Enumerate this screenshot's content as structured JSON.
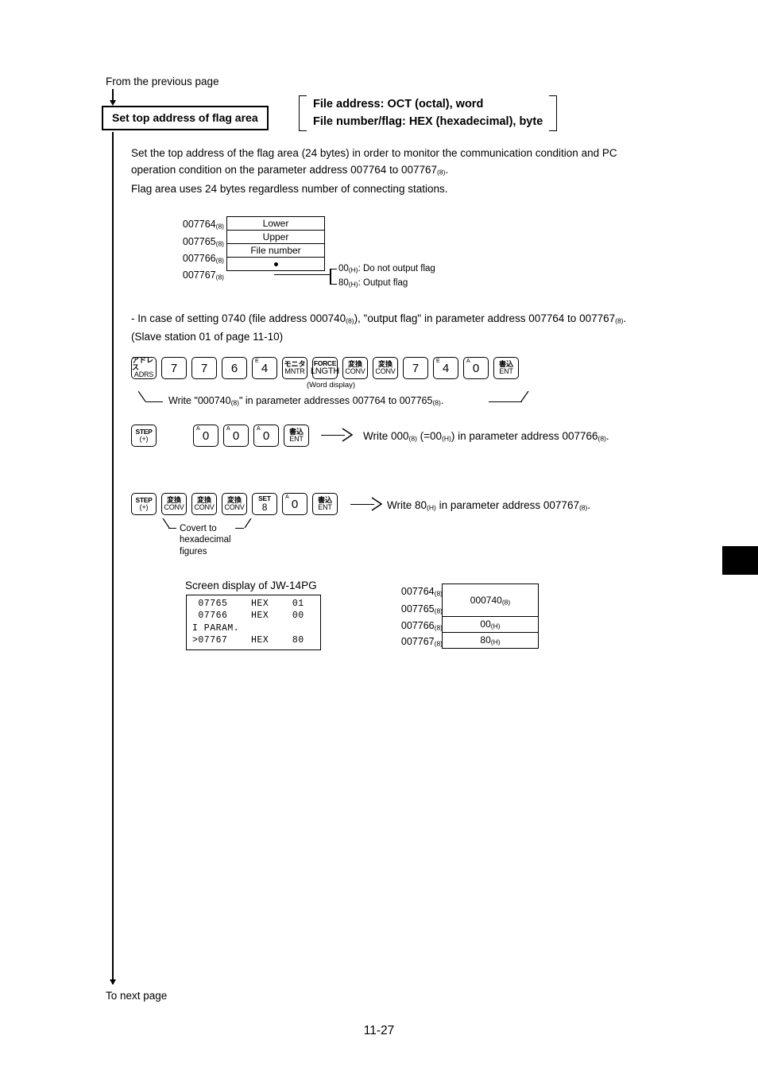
{
  "page": {
    "from_previous": "From the previous page",
    "to_next": "To next page",
    "page_number": "11-27"
  },
  "heading": {
    "title": "Set top address of flag area"
  },
  "note": {
    "line1": "File address: OCT (octal), word",
    "line2": "File number/flag: HEX (hexadecimal), byte"
  },
  "intro": {
    "line1_a": "Set the top address of the flag area (24 bytes) in order to monitor the communication condition and PC",
    "line2_a": "operation condition on the parameter address 007764 to 007767",
    "line2_sub": "(8)",
    "line2_b": ".",
    "line3": "Flag area uses 24 bytes regardless number of connecting stations."
  },
  "flag_table": {
    "rows": [
      {
        "addr": "007764",
        "addr_sub": "(8)",
        "value": "Lower"
      },
      {
        "addr": "007765",
        "addr_sub": "(8)",
        "value": "Upper"
      },
      {
        "addr": "007766",
        "addr_sub": "(8)",
        "value": "File number"
      },
      {
        "addr": "007767",
        "addr_sub": "(8)",
        "value": ""
      }
    ],
    "callouts": [
      {
        "code": "00",
        "code_sub": "(H)",
        "text": ": Do not output flag"
      },
      {
        "code": "80",
        "code_sub": "(H)",
        "text": ": Output flag"
      }
    ]
  },
  "example": {
    "line1_a": "- In case of setting   0740 (file address 000740",
    "line1_sub1": "(8)",
    "line1_b": "), \"output flag\" in parameter address 007764 to 007767",
    "line1_sub2": "(8)",
    "line1_c": ".",
    "line2": "(Slave station 01 of page 11-10)"
  },
  "key_sequence_1": {
    "keys": [
      {
        "name": "adrs",
        "top": "アドレス",
        "bottom": "ADRS",
        "style": "jp"
      },
      {
        "name": "digit-7",
        "big": "7",
        "style": "big"
      },
      {
        "name": "digit-7",
        "big": "7",
        "style": "big"
      },
      {
        "name": "digit-6",
        "big": "6",
        "style": "big"
      },
      {
        "name": "digit-4",
        "big": "4",
        "corner": "E",
        "style": "big-corner"
      },
      {
        "name": "mntr",
        "top": "モニタ",
        "bottom": "MNTR",
        "style": "jp"
      },
      {
        "name": "lngth",
        "top": "FORCE",
        "bottom": "LNGTH",
        "style": "force"
      },
      {
        "name": "conv",
        "top": "変換",
        "bottom": "CONV",
        "style": "jp"
      },
      {
        "name": "conv",
        "top": "変換",
        "bottom": "CONV",
        "style": "jp"
      },
      {
        "name": "digit-7",
        "big": "7",
        "style": "big"
      },
      {
        "name": "digit-4",
        "big": "4",
        "corner": "E",
        "style": "big-corner"
      },
      {
        "name": "digit-0",
        "big": "0",
        "corner": "A",
        "style": "big-corner"
      },
      {
        "name": "ent",
        "top": "書込",
        "bottom": "ENT",
        "style": "jp"
      }
    ],
    "word_display": "(Word display)",
    "caption_a": "Write \"000740",
    "caption_sub1": "(8)",
    "caption_b": "\" in parameter addresses 007764 to 007765",
    "caption_sub2": "(8)",
    "caption_c": "."
  },
  "key_sequence_2": {
    "keys": [
      {
        "name": "step-plus",
        "top": "STEP",
        "bottom": "(+)",
        "style": "stk"
      },
      {
        "name": "digit-0",
        "big": "0",
        "corner": "A",
        "style": "big-corner"
      },
      {
        "name": "digit-0",
        "big": "0",
        "corner": "A",
        "style": "big-corner"
      },
      {
        "name": "digit-0",
        "big": "0",
        "corner": "A",
        "style": "big-corner"
      },
      {
        "name": "ent",
        "top": "書込",
        "bottom": "ENT",
        "style": "jp"
      }
    ],
    "result_a": "Write 000",
    "result_sub1": "(8)",
    "result_b": " (=00",
    "result_sub2": "(H)",
    "result_c": ") in parameter address 007766",
    "result_sub3": "(8)",
    "result_d": "."
  },
  "key_sequence_3": {
    "keys": [
      {
        "name": "step-plus",
        "top": "STEP",
        "bottom": "(+)",
        "style": "stk"
      },
      {
        "name": "conv",
        "top": "変換",
        "bottom": "CONV",
        "style": "jp"
      },
      {
        "name": "conv",
        "top": "変換",
        "bottom": "CONV",
        "style": "jp"
      },
      {
        "name": "conv",
        "top": "変換",
        "bottom": "CONV",
        "style": "jp"
      },
      {
        "name": "set-8",
        "top": "SET",
        "bottom": "8",
        "style": "stk"
      },
      {
        "name": "digit-0",
        "big": "0",
        "corner": "A",
        "style": "big-corner"
      },
      {
        "name": "ent",
        "top": "書込",
        "bottom": "ENT",
        "style": "jp"
      }
    ],
    "leader_line1": "Covert to",
    "leader_line2": "hexadecimal",
    "leader_line3": "figures",
    "result_a": "Write 80",
    "result_sub1": "(H)",
    "result_b": " in parameter address 007767",
    "result_sub2": "(8)",
    "result_c": "."
  },
  "monitor": {
    "caption": "Screen display of JW-14PG",
    "lines": [
      " 07765    HEX    01",
      " 07766    HEX    00",
      "I PARAM.",
      ">07767    HEX    80"
    ]
  },
  "result_table": {
    "rows": [
      {
        "addr": "007764",
        "addr_sub": "(8)"
      },
      {
        "addr": "007765",
        "addr_sub": "(8)"
      },
      {
        "addr": "007766",
        "addr_sub": "(8)"
      },
      {
        "addr": "007767",
        "addr_sub": "(8)"
      }
    ],
    "cells": [
      {
        "value": "000740",
        "value_sub": "(8)"
      },
      {
        "value": "00",
        "value_sub": "(H)"
      },
      {
        "value": "80",
        "value_sub": "(H)"
      }
    ]
  },
  "colors": {
    "ink": "#000000",
    "paper": "#ffffff"
  }
}
